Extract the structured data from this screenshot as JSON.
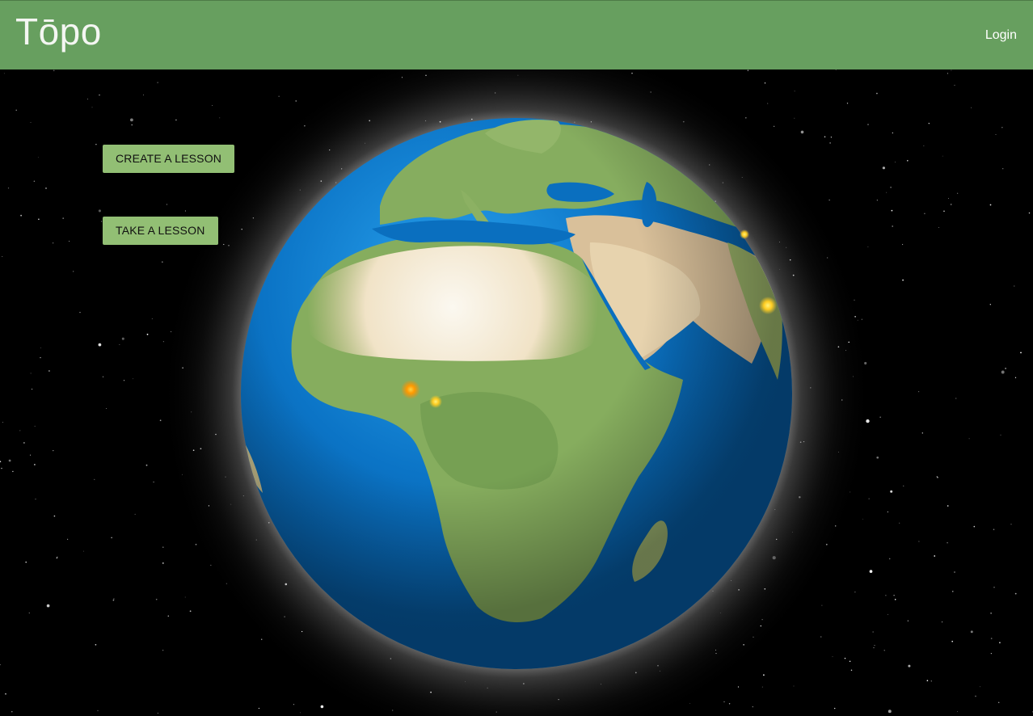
{
  "header": {
    "brand": "Tōpo",
    "login_label": "Login"
  },
  "actions": {
    "create_label": "CREATE A LESSON",
    "take_label": "TAKE A LESSON"
  },
  "globe": {
    "view": "Africa, Europe and Middle East",
    "markers": [
      {
        "name": "marker-west-africa",
        "color": "#ffa800"
      },
      {
        "name": "marker-nigeria",
        "color": "#ffcc22"
      },
      {
        "name": "marker-india-north",
        "color": "#ffcc22"
      },
      {
        "name": "marker-india-south",
        "color": "#ffdd33"
      }
    ]
  },
  "colors": {
    "header_bg": "#679f5f",
    "button_bg": "#92bf74",
    "ocean": "#0a6fc2",
    "land": "#8fb46a",
    "desert": "#efe3c9",
    "background": "#000000"
  }
}
